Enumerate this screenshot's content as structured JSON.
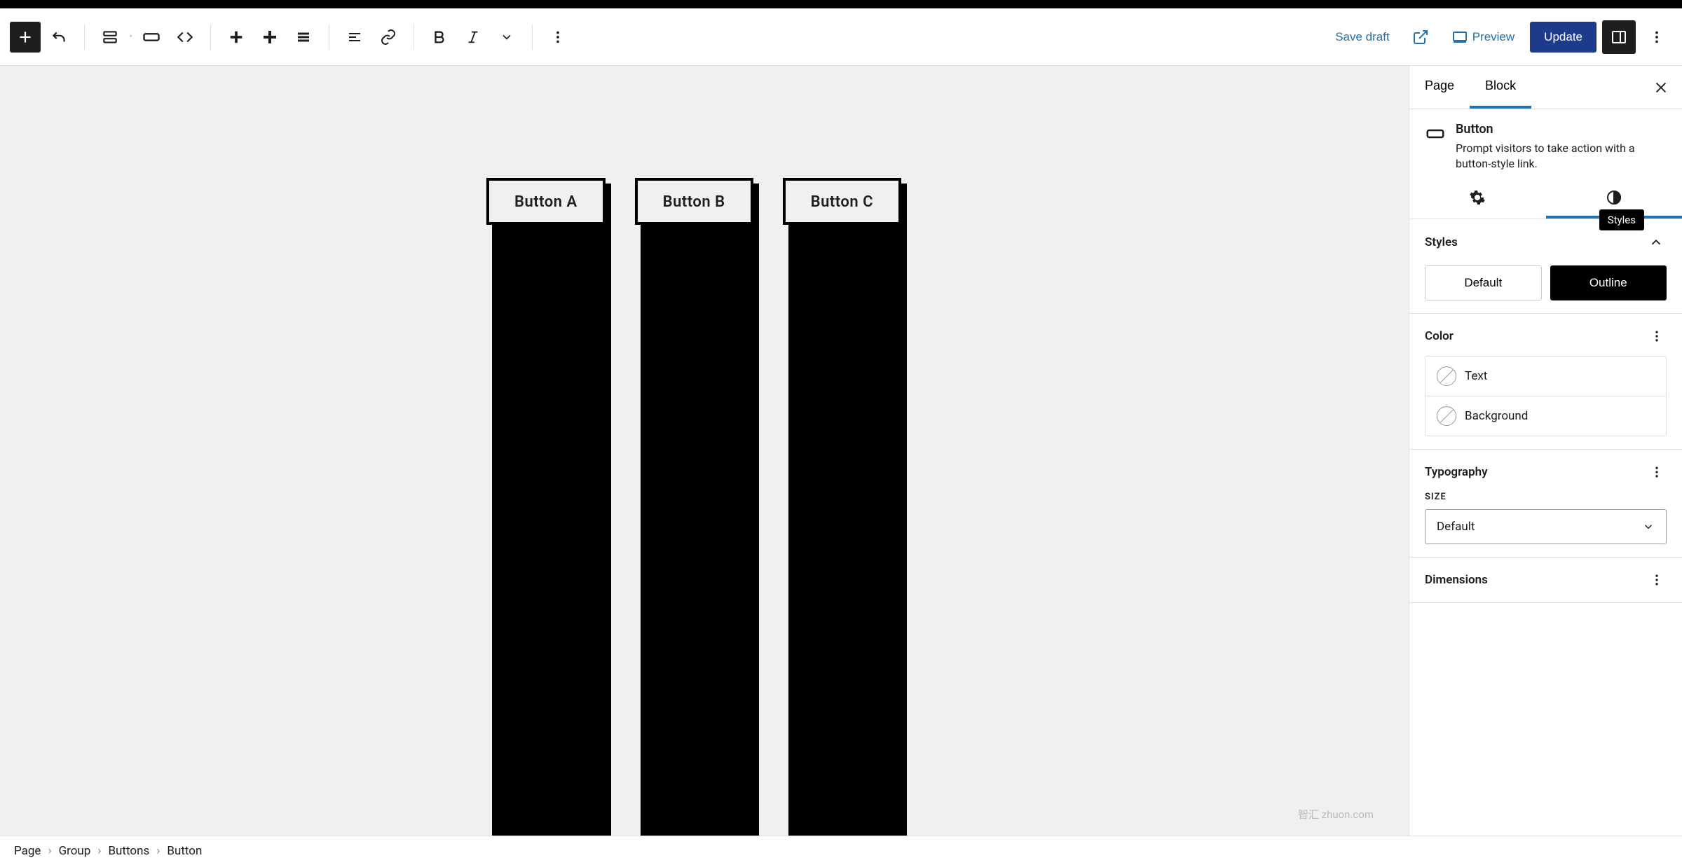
{
  "toolbar": {
    "save_draft": "Save draft",
    "preview": "Preview",
    "update": "Update"
  },
  "canvas": {
    "buttons": [
      "Button A",
      "Button B",
      "Button C"
    ]
  },
  "sidebar": {
    "tabs": {
      "page": "Page",
      "block": "Block"
    },
    "block": {
      "name": "Button",
      "description": "Prompt visitors to take action with a button-style link."
    },
    "styles": {
      "heading": "Styles",
      "tooltip": "Styles",
      "default": "Default",
      "outline": "Outline"
    },
    "color": {
      "heading": "Color",
      "text": "Text",
      "background": "Background"
    },
    "typography": {
      "heading": "Typography",
      "size_label": "SIZE",
      "size_value": "Default"
    },
    "dimensions": {
      "heading": "Dimensions"
    }
  },
  "breadcrumbs": [
    "Page",
    "Group",
    "Buttons",
    "Button"
  ],
  "watermark": "智汇 zhuon.com"
}
